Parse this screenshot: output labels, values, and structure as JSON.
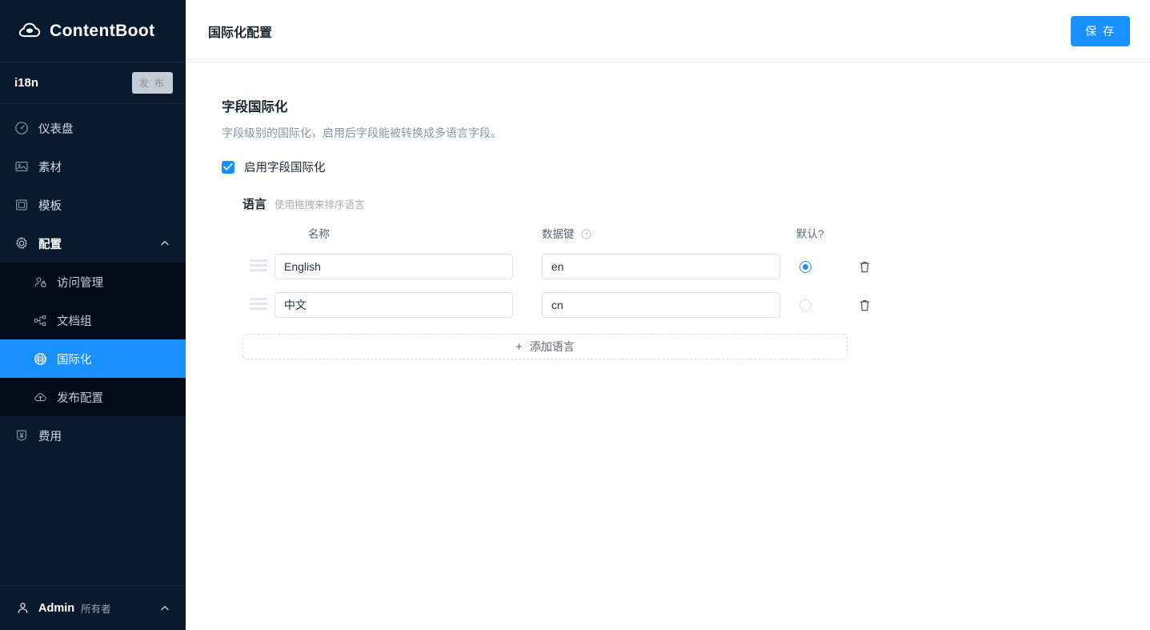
{
  "brand": {
    "name": "ContentBoot",
    "logo_icon": "cloud-icon"
  },
  "sidebar": {
    "project": {
      "name": "i18n",
      "publish_label": "发 布"
    },
    "items": [
      {
        "label": "仪表盘",
        "icon": "gauge-icon"
      },
      {
        "label": "素材",
        "icon": "image-icon"
      },
      {
        "label": "模板",
        "icon": "template-icon"
      },
      {
        "label": "配置",
        "icon": "gear-icon",
        "expanded": true,
        "chevron": "chevron-up-icon"
      }
    ],
    "sub_items": [
      {
        "label": "访问管理",
        "icon": "user-lock-icon",
        "active": false
      },
      {
        "label": "文档组",
        "icon": "node-tree-icon",
        "active": false
      },
      {
        "label": "国际化",
        "icon": "globe-icon",
        "active": true
      },
      {
        "label": "发布配置",
        "icon": "cloud-upload-icon",
        "active": false
      }
    ],
    "items_after": [
      {
        "label": "费用",
        "icon": "money-shield-icon"
      }
    ],
    "user": {
      "name": "Admin",
      "role": "所有者",
      "avatar_icon": "user-icon",
      "chevron": "chevron-up-icon"
    }
  },
  "header": {
    "title": "国际化配置",
    "save_label": "保 存",
    "accent_color": "#1890ff"
  },
  "main": {
    "section_title": "字段国际化",
    "section_desc": "字段级别的国际化，启用后字段能被转换成多语言字段。",
    "enable_checkbox": {
      "label": "启用字段国际化",
      "checked": true
    },
    "lang_group": {
      "title": "语言",
      "hint": "使用拖拽来排序语言",
      "columns": {
        "name": "名称",
        "key": "数据键",
        "key_help_icon": "question-circle-icon",
        "default": "默认?"
      },
      "rows": [
        {
          "handle_icon": "drag-handle-icon",
          "name": "English",
          "key": "en",
          "is_default": true,
          "delete_icon": "trash-icon"
        },
        {
          "handle_icon": "drag-handle-icon",
          "name": "中文",
          "key": "cn",
          "is_default": false,
          "delete_icon": "trash-icon"
        }
      ],
      "name_placeholder": "名称",
      "key_placeholder": "数据键",
      "add_label": "添加语言",
      "add_icon": "plus-icon"
    }
  }
}
